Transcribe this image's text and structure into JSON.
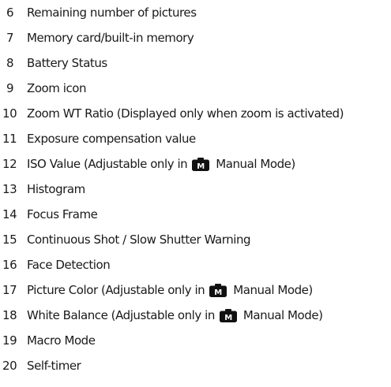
{
  "items": [
    {
      "num": "6",
      "text": "Remaining number of pictures"
    },
    {
      "num": "7",
      "text": "Memory card/built-in memory"
    },
    {
      "num": "8",
      "text": "Battery Status"
    },
    {
      "num": "9",
      "text": "Zoom icon"
    },
    {
      "num": "10",
      "text": "Zoom WT Ratio (Displayed only when zoom is activated)"
    },
    {
      "num": "11",
      "text": "Exposure compensation value"
    },
    {
      "num": "12",
      "text_before": "ISO Value (Adjustable only in",
      "icon": "manual-mode-camera-icon",
      "icon_letter": "M",
      "text_after": "Manual Mode)"
    },
    {
      "num": "13",
      "text": "Histogram"
    },
    {
      "num": "14",
      "text": "Focus Frame"
    },
    {
      "num": "15",
      "text": "Continuous Shot / Slow Shutter Warning"
    },
    {
      "num": "16",
      "text": "Face Detection"
    },
    {
      "num": "17",
      "text_before": "Picture Color (Adjustable only in",
      "icon": "manual-mode-camera-icon",
      "icon_letter": "M",
      "text_after": "Manual Mode)"
    },
    {
      "num": "18",
      "text_before": "White Balance (Adjustable only in",
      "icon": "manual-mode-camera-icon",
      "icon_letter": "M",
      "text_after": "Manual Mode)"
    },
    {
      "num": "19",
      "text": "Macro Mode"
    },
    {
      "num": "20",
      "text": "Self-timer"
    }
  ],
  "colors": {
    "text": "#1a1a1a",
    "icon_bg": "#111111",
    "icon_letter": "#ffffff"
  }
}
